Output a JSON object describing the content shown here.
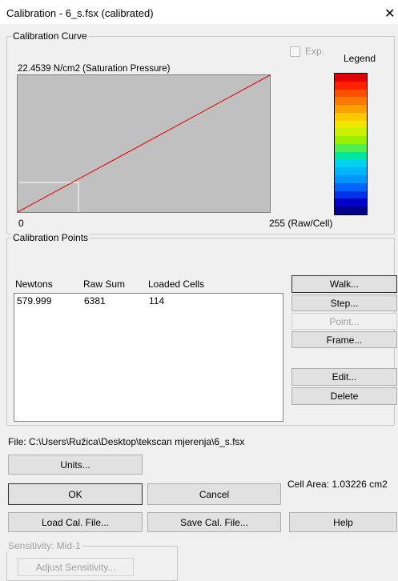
{
  "window": {
    "title": "Calibration - 6_s.fsx (calibrated)",
    "close_glyph": "✕"
  },
  "curve_group": {
    "label": "Calibration Curve",
    "exp_label": "Exp.",
    "legend_label": "Legend",
    "y_max_label": "22.4539 N/cm2 (Saturation Pressure)",
    "x_min_label": "0",
    "x_max_label": "255  (Raw/Cell)",
    "plot_bg": "#c0c0c0",
    "line_color": "#e00000",
    "legend_colors": [
      "#e00000",
      "#ff2000",
      "#ff5000",
      "#ff7800",
      "#ffa000",
      "#ffc800",
      "#f0e600",
      "#c8f000",
      "#96f000",
      "#50f050",
      "#00e6a0",
      "#00d2f0",
      "#00b4ff",
      "#0096ff",
      "#0064ff",
      "#0032e6",
      "#0000c8",
      "#00008c"
    ]
  },
  "points_group": {
    "label": "Calibration Points",
    "columns": [
      "Newtons",
      "Raw Sum",
      "Loaded Cells"
    ],
    "rows": [
      {
        "newtons": "579.999",
        "raw_sum": "6381",
        "loaded_cells": "114"
      }
    ]
  },
  "side_buttons": {
    "walk": "Walk...",
    "step": "Step...",
    "point": "Point...",
    "frame": "Frame...",
    "edit": "Edit...",
    "delete": "Delete"
  },
  "file_path": "File: C:\\Users\\Ružica\\Desktop\\tekscan mjerenja\\6_s.fsx",
  "buttons": {
    "units": "Units...",
    "ok": "OK",
    "cancel": "Cancel",
    "load": "Load Cal. File...",
    "save": "Save Cal. File...",
    "help": "Help"
  },
  "cell_area": "Cell Area: 1.03226 cm2",
  "sensitivity": {
    "label": "Sensitivity: Mid-1",
    "adjust": "Adjust Sensitivity..."
  }
}
